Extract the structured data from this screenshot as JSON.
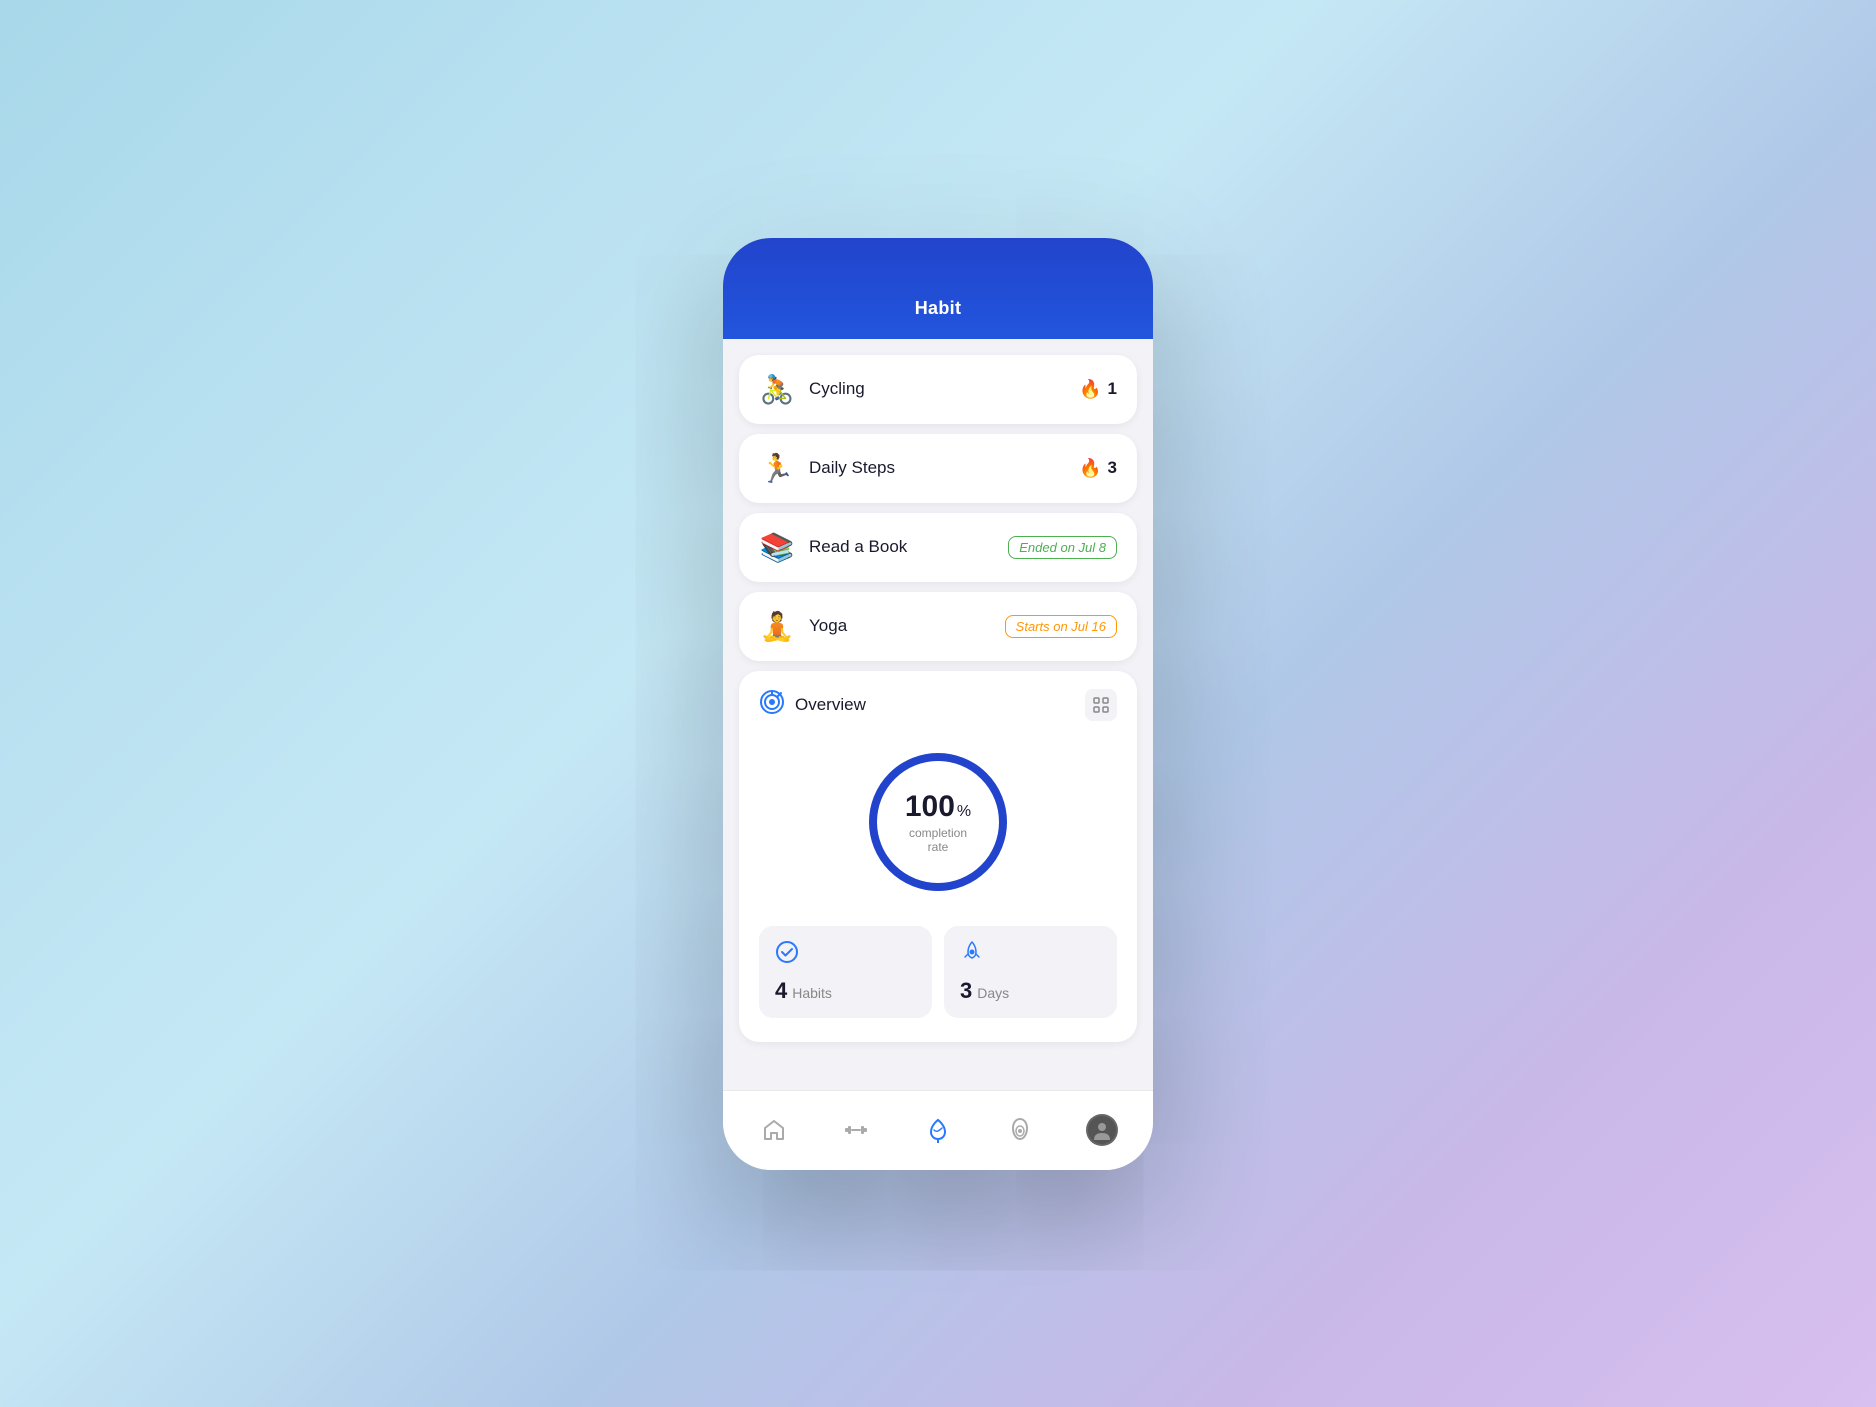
{
  "app": {
    "title": "Habit"
  },
  "habits": [
    {
      "id": "cycling",
      "emoji": "🚴",
      "name": "Cycling",
      "streak": 1,
      "status": "streak"
    },
    {
      "id": "daily-steps",
      "emoji": "🏃",
      "name": "Daily Steps",
      "streak": 3,
      "status": "streak"
    },
    {
      "id": "read-a-book",
      "emoji": "📚",
      "name": "Read a Book",
      "badge": "Ended on Jul 8",
      "status": "ended"
    },
    {
      "id": "yoga",
      "emoji": "🧘",
      "name": "Yoga",
      "badge": "Starts on Jul 16",
      "status": "starts"
    }
  ],
  "overview": {
    "title": "Overview",
    "completion_percent": "100",
    "completion_label": "completion rate",
    "stats": [
      {
        "type": "habits",
        "value": "4",
        "label": "Habits"
      },
      {
        "type": "days",
        "value": "3",
        "label": "Days"
      }
    ]
  },
  "nav": {
    "items": [
      {
        "id": "home",
        "label": "Home"
      },
      {
        "id": "workout",
        "label": "Workout"
      },
      {
        "id": "nature",
        "label": "Nature"
      },
      {
        "id": "nutrition",
        "label": "Nutrition"
      },
      {
        "id": "profile",
        "label": "Profile"
      }
    ]
  }
}
